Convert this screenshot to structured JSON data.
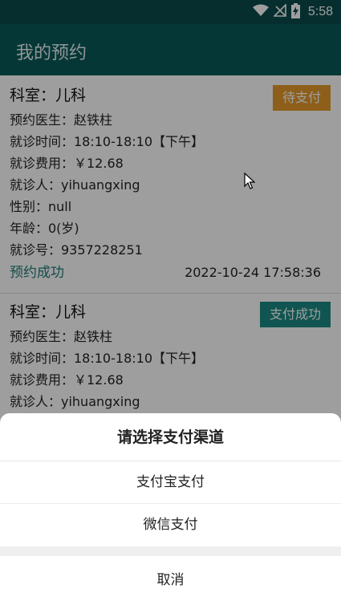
{
  "status_bar": {
    "time": "5:58",
    "icons": [
      "wifi-icon",
      "no-signal-icon",
      "battery-charging-icon"
    ]
  },
  "app_bar": {
    "title": "我的预约"
  },
  "appointments": [
    {
      "department": "科室：儿科",
      "badge": "待支付",
      "doctor": "预约医生：赵铁柱",
      "visit_time": "就诊时间：18:10-18:10【下午】",
      "fee": "就诊费用：￥12.68",
      "patient": "就诊人：yihuangxing",
      "gender": "性别：null",
      "age": "年龄：0(岁)",
      "visit_no": "就诊号：9357228251",
      "status": "预约成功",
      "timestamp": "2022-10-24 17:58:36"
    },
    {
      "department": "科室：儿科",
      "badge": "支付成功",
      "doctor": "预约医生：赵铁柱",
      "visit_time": "就诊时间：18:10-18:10【下午】",
      "fee": "就诊费用：￥12.68",
      "patient": "就诊人：yihuangxing"
    }
  ],
  "payment_sheet": {
    "title": "请选择支付渠道",
    "options": [
      "支付宝支付",
      "微信支付"
    ],
    "cancel": "取消"
  },
  "colors": {
    "primary": "#0b5a5a",
    "status_bar": "#0b4b4b",
    "pending_badge": "#e69a2a",
    "paid_badge": "#1a8a84",
    "success_text": "#1f7d77"
  }
}
